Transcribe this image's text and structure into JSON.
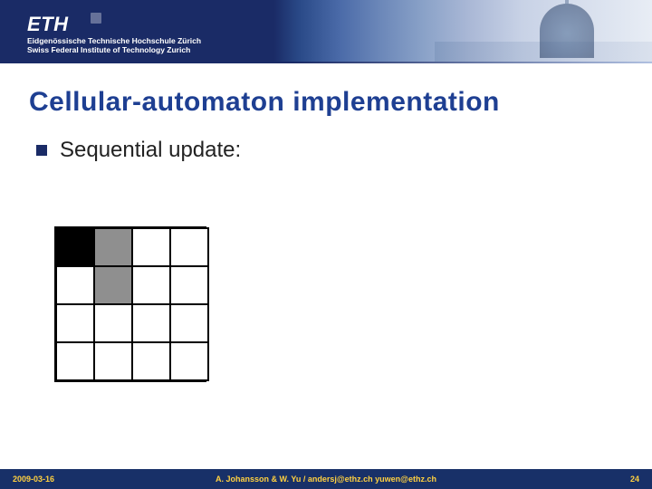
{
  "header": {
    "logo_text": "ETH",
    "subtitle_line1": "Eidgenössische Technische Hochschule Zürich",
    "subtitle_line2": "Swiss Federal Institute of Technology Zurich"
  },
  "title": "Cellular-automaton implementation",
  "bullet": {
    "text": "Sequential update:"
  },
  "grid": {
    "rows": 4,
    "cols": 4,
    "cells": [
      [
        "black",
        "gray",
        "white",
        "white"
      ],
      [
        "white",
        "gray",
        "white",
        "white"
      ],
      [
        "white",
        "white",
        "white",
        "white"
      ],
      [
        "white",
        "white",
        "white",
        "white"
      ]
    ]
  },
  "footer": {
    "date": "2009-03-16",
    "authors": "A. Johansson & W. Yu / andersj@ethz.ch yuwen@ethz.ch",
    "page": "24"
  },
  "colors": {
    "title_color": "#1e3f92",
    "footer_bg": "#183068",
    "footer_text": "#ffd040",
    "bullet_square": "#1a2b66"
  }
}
